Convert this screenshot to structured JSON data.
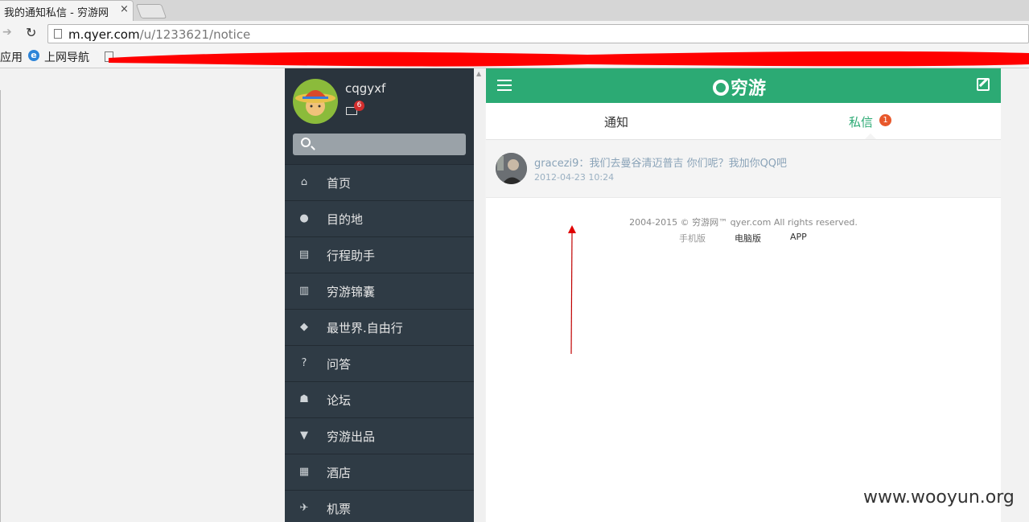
{
  "browser": {
    "tab_title": "我的通知私信 - 穷游网",
    "tab_close": "×",
    "url_host": "m.qyer.com",
    "url_path": "/u/1233621/notice",
    "bookmarks": [
      {
        "label": "应用"
      },
      {
        "label": "上网导航"
      }
    ]
  },
  "sidebar": {
    "username": "cqgyxf",
    "mail_badge": "6",
    "search_placeholder": "",
    "items": [
      {
        "label": "首页",
        "icon": "home-icon",
        "glyph": "⌂"
      },
      {
        "label": "目的地",
        "icon": "location-pin-icon",
        "glyph": "●"
      },
      {
        "label": "行程助手",
        "icon": "calendar-icon",
        "glyph": "▤"
      },
      {
        "label": "穷游锦囊",
        "icon": "guidebook-icon",
        "glyph": "▥"
      },
      {
        "label": "最世界.自由行",
        "icon": "tag-icon",
        "glyph": "◆"
      },
      {
        "label": "问答",
        "icon": "question-icon",
        "glyph": "?"
      },
      {
        "label": "论坛",
        "icon": "people-icon",
        "glyph": "☗"
      },
      {
        "label": "穷游出品",
        "icon": "shirt-icon",
        "glyph": "▼"
      },
      {
        "label": "酒店",
        "icon": "hotel-icon",
        "glyph": "▦"
      },
      {
        "label": "机票",
        "icon": "airplane-icon",
        "glyph": "✈"
      }
    ]
  },
  "main": {
    "logo_text": "穷游",
    "tabs": {
      "notice": "通知",
      "messages": "私信",
      "messages_badge": "1"
    },
    "message": {
      "sender": "gracezi9",
      "separator": "：",
      "text": "我们去曼谷清迈普吉 你们呢？我加你QQ吧",
      "time": "2012-04-23 10:24"
    },
    "footer": {
      "copyright": "2004-2015 © 穷游网™ qyer.com All rights reserved.",
      "links": [
        "手机版",
        "电脑版",
        "APP"
      ]
    }
  },
  "watermark": "www.wooyun.org",
  "colors": {
    "brand_green": "#2caa74",
    "sidebar_bg": "#2f3b45",
    "badge_red": "#d32d2d",
    "badge_orange": "#e8582b",
    "annotation_red": "#e00000"
  }
}
